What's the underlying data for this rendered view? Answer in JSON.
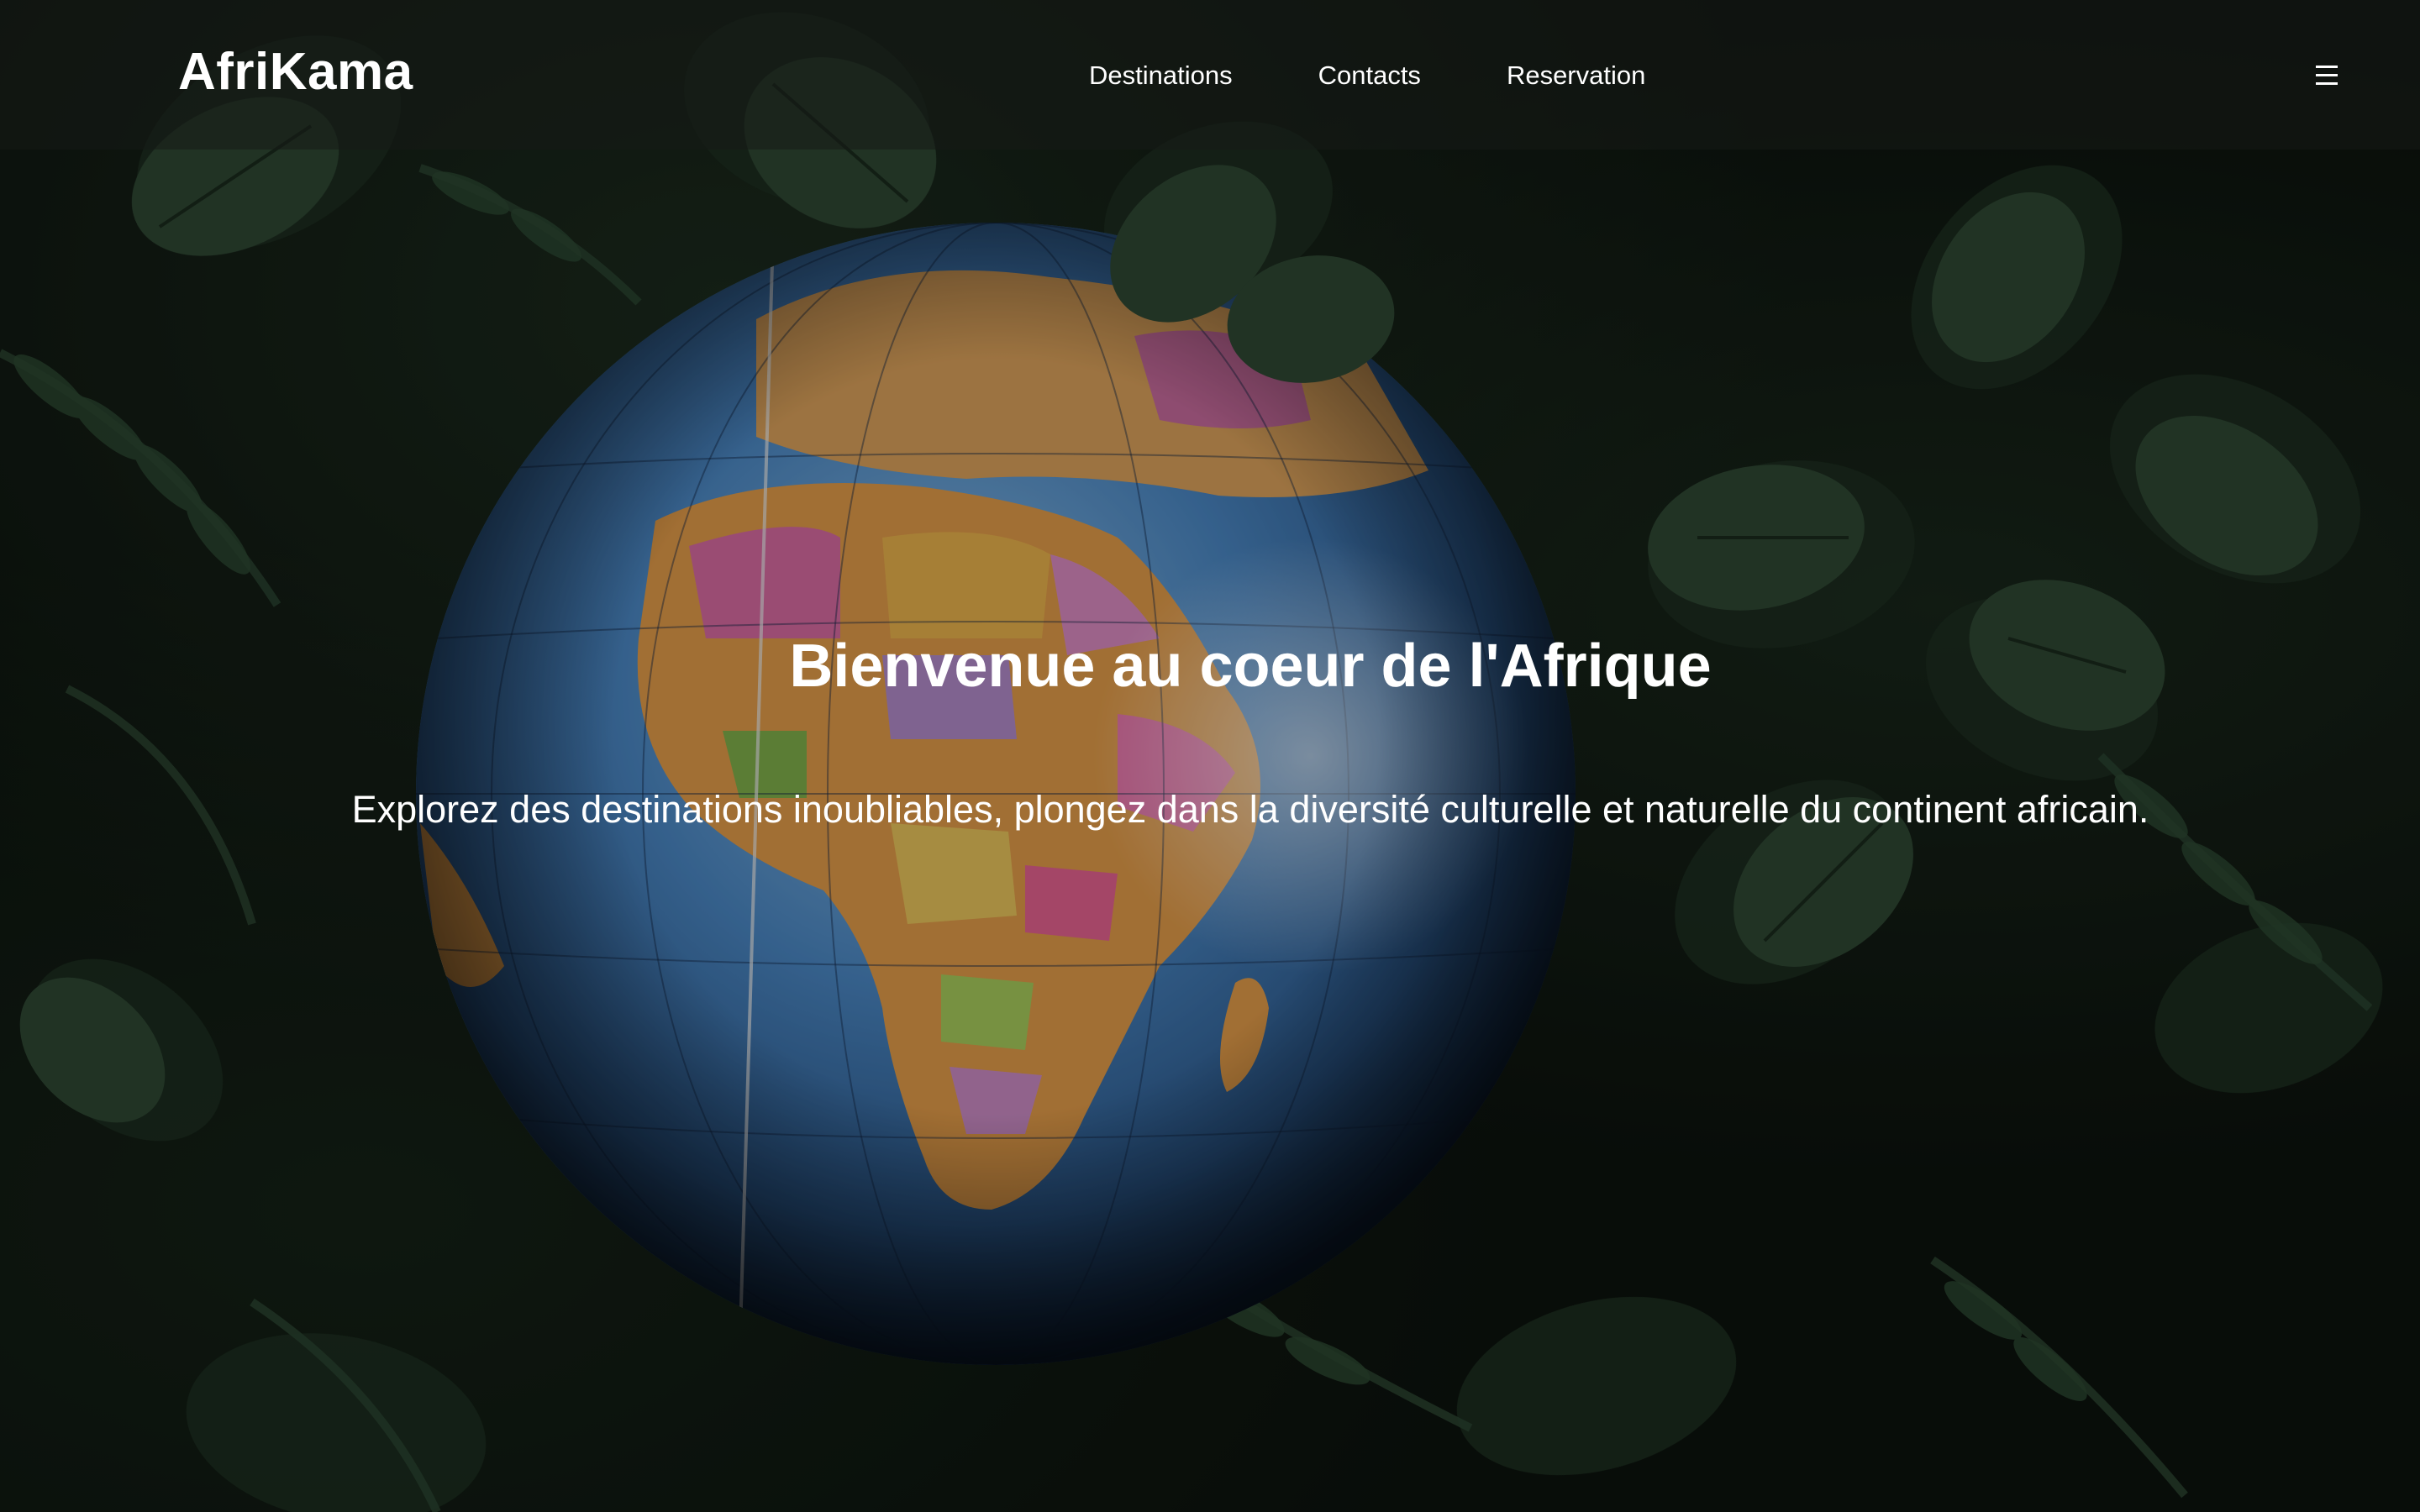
{
  "header": {
    "brand": "AfriKama",
    "nav": [
      {
        "label": "Destinations"
      },
      {
        "label": "Contacts"
      },
      {
        "label": "Reservation"
      }
    ],
    "menu_icon": "hamburger-menu-icon"
  },
  "hero": {
    "title": "Bienvenue au coeur de l'Afrique",
    "subtitle": "Explorez des destinations inoubliables, plongez dans la diversité culturelle et naturelle du continent africain.",
    "background": "globe-among-leaves-photo"
  },
  "colors": {
    "text": "#ffffff",
    "navbar_bg": "#161a16",
    "leaf_green": "#2f4a33",
    "ocean_blue": "#3f79b8",
    "land_orange": "#d99a4a"
  }
}
